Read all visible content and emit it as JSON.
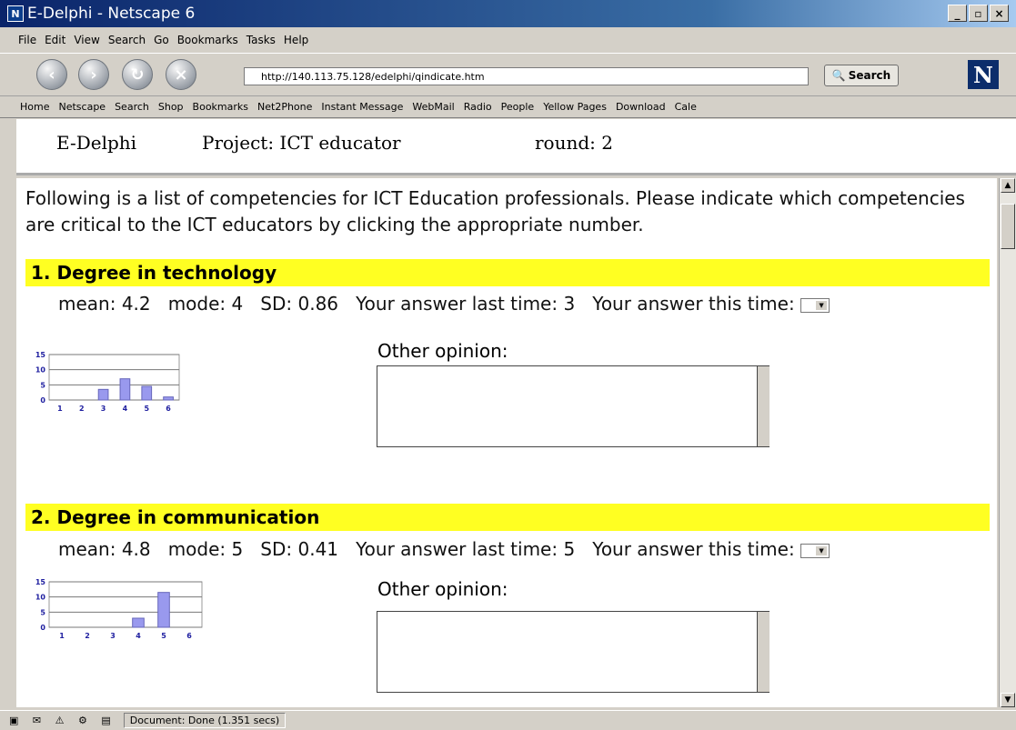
{
  "window": {
    "title": "E-Delphi - Netscape 6"
  },
  "menu": [
    "File",
    "Edit",
    "View",
    "Search",
    "Go",
    "Bookmarks",
    "Tasks",
    "Help"
  ],
  "nav": {
    "url": "http://140.113.75.128/edelphi/qindicate.htm",
    "search_label": "Search",
    "logo": "N"
  },
  "personal_toolbar": [
    "Home",
    "Netscape",
    "Search",
    "Shop",
    "Bookmarks",
    "Net2Phone",
    "Instant Message",
    "WebMail",
    "Radio",
    "People",
    "Yellow Pages",
    "Download",
    "Cale"
  ],
  "header": {
    "app": "E-Delphi",
    "project": "Project: ICT educator",
    "round": "round: 2"
  },
  "intro": "Following is a list of competencies for ICT Education professionals. Please indicate which competencies are critical to the ICT educators by clicking the appropriate number.",
  "questions": [
    {
      "title": "1. Degree in technology",
      "stats": "mean: 4.2   mode: 4   SD: 0.86   Your answer last time: 3   Your answer this time:",
      "opinion_label": "Other opinion:"
    },
    {
      "title": "2. Degree in communication",
      "stats": "mean: 4.8   mode: 5   SD: 0.41   Your answer last time: 5   Your answer this time:",
      "opinion_label": "Other opinion:"
    }
  ],
  "chart_data": [
    {
      "type": "bar",
      "categories": [
        "1",
        "2",
        "3",
        "4",
        "5",
        "6"
      ],
      "values": [
        0,
        0,
        3.5,
        7,
        4.5,
        1
      ],
      "ylim": [
        0,
        15
      ],
      "yticks": [
        "15",
        "10",
        "5",
        "0"
      ]
    },
    {
      "type": "bar",
      "categories": [
        "1",
        "2",
        "3",
        "4",
        "5",
        "6"
      ],
      "values": [
        0,
        0,
        0,
        3,
        11.5,
        0
      ],
      "ylim": [
        0,
        15
      ],
      "yticks": [
        "15",
        "10",
        "5",
        "0"
      ]
    }
  ],
  "status": {
    "text": "Document: Done (1.351 secs)"
  },
  "colors": {
    "question_bar": "#ffff22",
    "bar_fill": "#9999ee",
    "tick_color": "#2020a0"
  }
}
